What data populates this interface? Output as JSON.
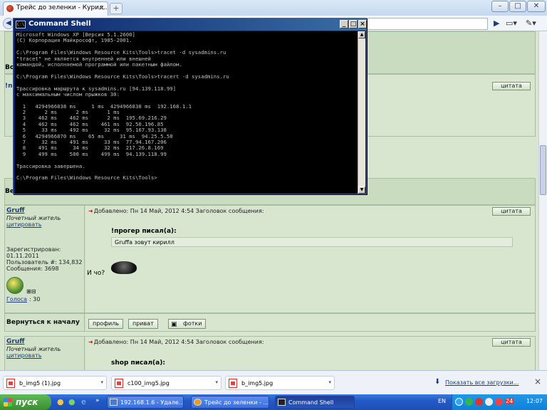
{
  "browser": {
    "tab_title": "Трейс до зеленки - Курил...",
    "tab_close": "×",
    "new_tab": "+",
    "win_minimize": "–",
    "win_maximize": "□",
    "win_close": "✕",
    "nav_back": "◀",
    "go": "▶",
    "page_menu": "▭▾",
    "tools_menu": "✎▾"
  },
  "console": {
    "title": "Command Shell",
    "icon_text": "C:\\",
    "btn_minimize": "_",
    "btn_maximize": "□",
    "btn_close": "×",
    "scroll_up": "▲",
    "scroll_down": "▼",
    "lines": [
      "Microsoft Windows XP [Версия 5.1.2600]",
      "(С) Корпорация Майкрософт, 1985-2001.",
      "",
      "C:\\Program Files\\Windows Resource Kits\\Tools>tracet -d sysadmins.ru",
      "\"tracet\" не является внутренней или внешней",
      "командой, исполняемой программой или пакетным файлом.",
      "",
      "C:\\Program Files\\Windows Resource Kits\\Tools>tracert -d sysadmins.ru",
      "",
      "Трассировка маршрута к sysadmins.ru [94.139.118.99]",
      "с максимальным числом прыжков 30:",
      "",
      "  1   4294966838 ms     1 ms  4294966838 ms  192.168.1.1",
      "  2      2 ms      2 ms      1 ms",
      "  3    462 ms    462 ms      2 ms  195.69.216.29",
      "  4    462 ms    462 ms    461 ms  92.50.196.85",
      "  5     33 ms    492 ms     32 ms  95.167.93.138",
      "  6   4294966870 ms    65 ms     31 ms  94.25.5.50",
      "  7     32 ms    491 ms     33 ms  77.94.167.206",
      "  8    491 ms     34 ms     32 ms  217.26.8.169",
      "  9    499 ms    500 ms    499 ms  94.139.118.99",
      "",
      "Трассировка завершена.",
      "",
      "C:\\Program Files\\Windows Resource Kits\\Tools>"
    ]
  },
  "forum": {
    "peek_labels": [
      "Во",
      "!n",
      "Ве"
    ],
    "top_quote_btn": "цитата",
    "post1": {
      "author": "Gruff",
      "role": "Почетный житель",
      "cite_link": "цитировать",
      "header": "Добавлено: Пн 14 Май, 2012 4:54    Заголовок сообщения:",
      "quote_btn": "цитата",
      "quote_author": "!прогер писал(а):",
      "quote_text": "Gruffa зовут кирилл",
      "reply": "И чо?",
      "registered": "Зарегистрирован:",
      "reg_date": "01.11.2011",
      "user_no": "Пользователь #: 134,832",
      "posts": "Сообщения: 3698",
      "votes_link": "Голоса",
      "votes_value": ": 30",
      "vote_box": "⊞⊟"
    },
    "nav_row": {
      "back_to_top": "Вернуться к началу",
      "profile": "профиль",
      "private": "приват",
      "photos": "фотки"
    },
    "post2": {
      "author": "Gruff",
      "role": "Почетный житель",
      "cite_link": "цитировать",
      "header": "Добавлено: Пн 14 Май, 2012 4:54    Заголовок сообщения:",
      "quote_btn": "цитата",
      "quote_author": "shop писал(а):"
    }
  },
  "downloads": {
    "items": [
      {
        "name": "b_img5 (1).jpg"
      },
      {
        "name": "c100_img5.jpg"
      },
      {
        "name": "b_img5.jpg"
      }
    ],
    "dropdown": "▾",
    "show_all": "Показать все загрузки...",
    "close": "×"
  },
  "taskbar": {
    "start_label": "пуск",
    "quick_more": "»",
    "tasks": [
      {
        "label": "192.168.1.6 - Удале..."
      },
      {
        "label": "Трейс до зеленки - ..."
      },
      {
        "label": "Command Shell"
      }
    ],
    "language": "EN",
    "tray_number": "24",
    "clock": "12:07"
  }
}
